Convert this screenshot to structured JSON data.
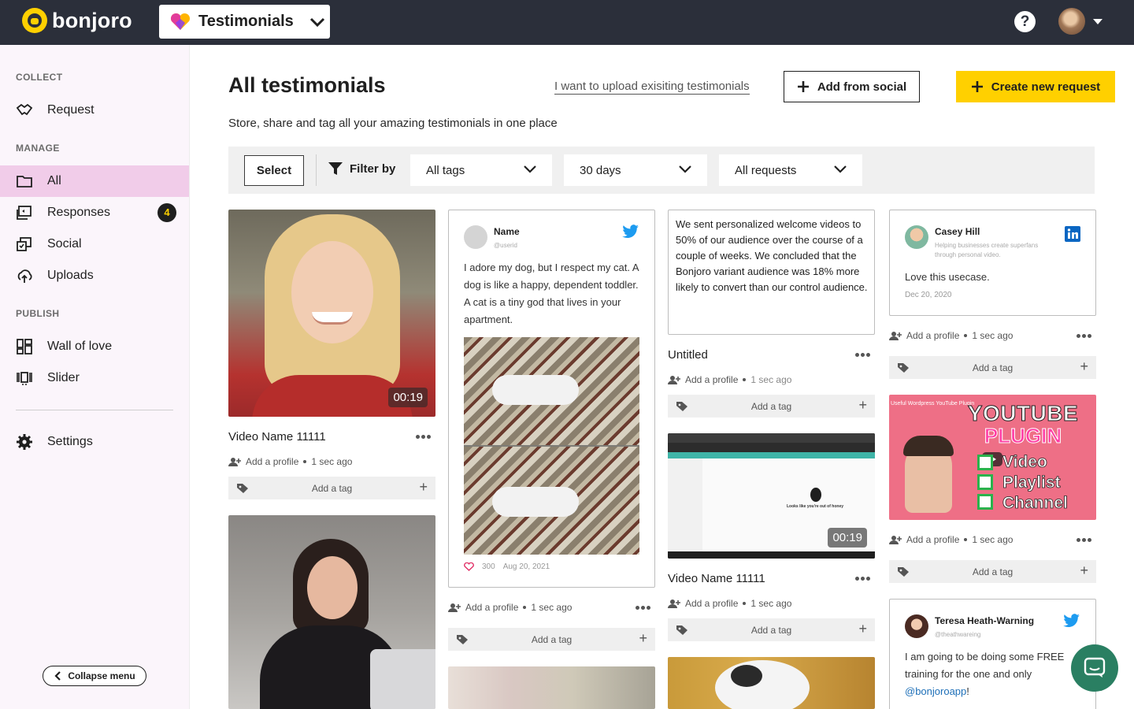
{
  "brand": {
    "name": "bonjoro",
    "accent": "#ffd000",
    "topbar": "#2b2f3a"
  },
  "app_switcher": {
    "label": "Testimonials"
  },
  "sidebar": {
    "sections": {
      "collect": "COLLECT",
      "manage": "MANAGE",
      "publish": "PUBLISH"
    },
    "items": {
      "request": "Request",
      "all": "All",
      "responses": "Responses",
      "responses_badge": "4",
      "social": "Social",
      "uploads": "Uploads",
      "wall": "Wall of love",
      "slider": "Slider",
      "settings": "Settings"
    },
    "collapse": "Collapse menu"
  },
  "header": {
    "title": "All testimonials",
    "upload_link": "I want to upload exisiting testimonials",
    "add_social": "Add from social",
    "create": "Create new request",
    "subtitle": "Store, share and tag all your amazing testimonials in one place"
  },
  "filters": {
    "select": "Select",
    "filter_by": "Filter by",
    "tags": "All tags",
    "days": "30 days",
    "requests": "All requests"
  },
  "cards": {
    "video1": {
      "duration": "00:19",
      "title": "Video Name 11111",
      "profile": "Add a profile",
      "time": "1 sec ago",
      "tag": "Add a tag"
    },
    "tweet1": {
      "name": "Name",
      "handle": "@userid",
      "body": "I adore my dog, but I respect my cat. A dog is like a happy, dependent toddler. A cat is a tiny god that lives in your apartment.",
      "likes": "300",
      "date": "Aug 20, 2021",
      "profile": "Add a profile",
      "time": "1 sec ago",
      "tag": "Add a tag"
    },
    "text1": {
      "body": "We sent personalized welcome videos to 50% of our audience over the course of a couple of weeks. We concluded that the Bonjoro variant audience was 18% more likely to convert than our control audience.",
      "title": "Untitled",
      "profile": "Add a profile",
      "time": "1 sec ago",
      "tag": "Add a tag"
    },
    "video2": {
      "duration": "00:19",
      "title": "Video Name 11111",
      "profile": "Add a profile",
      "time": "1 sec ago",
      "tag": "Add a tag",
      "screen_heading": "Looks like you're out of honey"
    },
    "linkedin1": {
      "name": "Casey Hill",
      "sub": "Helping businesses create superfans through personal video.",
      "body": "Love this usecase.",
      "date": "Dec 20, 2020",
      "profile": "Add a profile",
      "time": "1 sec ago",
      "tag": "Add a tag"
    },
    "youtube1": {
      "caption": "Useful Wordpress YouTube Plugin",
      "line1": "YOUTUBE",
      "line2": "PLUGIN",
      "item1": "Video",
      "item2": "Playlist",
      "item3": "Channel",
      "profile": "Add a profile",
      "time": "1 sec ago",
      "tag": "Add a tag"
    },
    "tweet2": {
      "name": "Teresa Heath-Warning",
      "handle": "@theathwareing",
      "body": "I am going to be doing some FREE training for the one and only",
      "mention": "@bonjoroapp",
      "tail": "!"
    }
  }
}
